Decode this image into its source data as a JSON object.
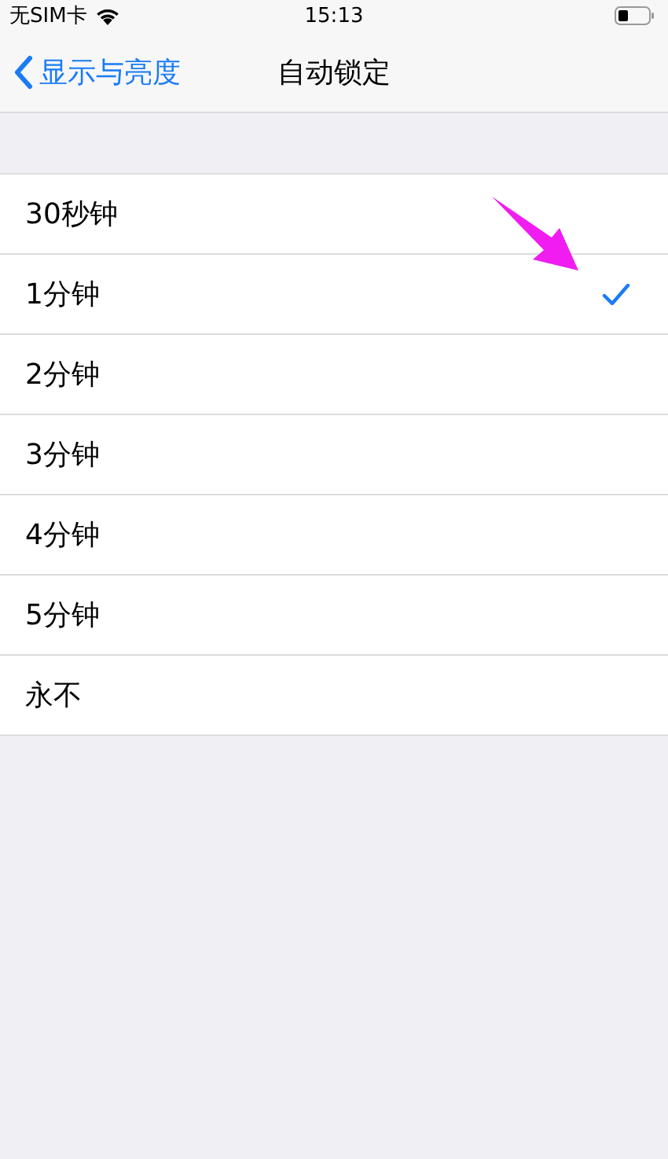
{
  "status_bar": {
    "carrier": "无SIM卡",
    "time": "15:13"
  },
  "nav": {
    "back_label": "显示与亮度",
    "title": "自动锁定"
  },
  "options": [
    {
      "label": "30秒钟",
      "selected": false
    },
    {
      "label": "1分钟",
      "selected": true
    },
    {
      "label": "2分钟",
      "selected": false
    },
    {
      "label": "3分钟",
      "selected": false
    },
    {
      "label": "4分钟",
      "selected": false
    },
    {
      "label": "5分钟",
      "selected": false
    },
    {
      "label": "永不",
      "selected": false
    }
  ]
}
